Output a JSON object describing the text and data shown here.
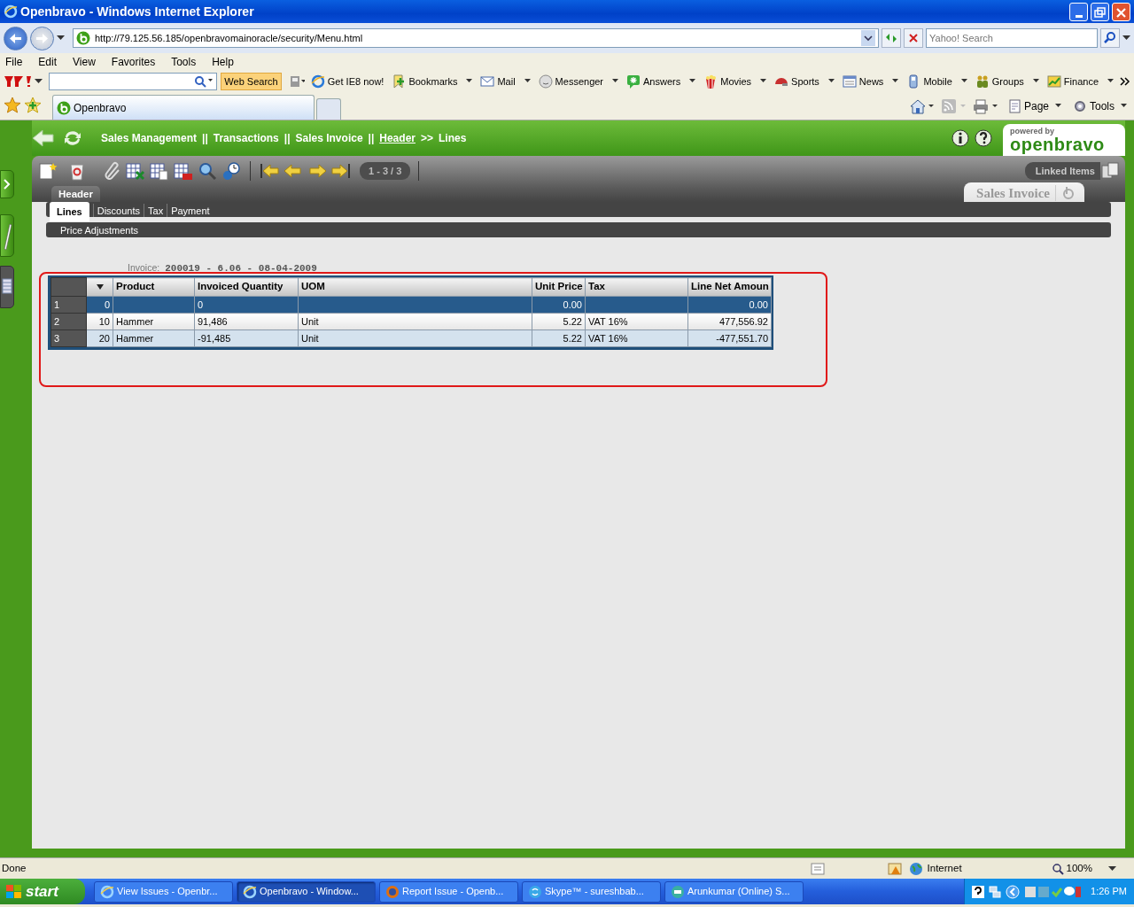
{
  "window": {
    "title": "Openbravo - Windows Internet Explorer"
  },
  "address_bar": {
    "url": "http://79.125.56.185/openbravomainoracle/security/Menu.html",
    "search_placeholder": "Yahoo! Search"
  },
  "menu_bar": [
    "File",
    "Edit",
    "View",
    "Favorites",
    "Tools",
    "Help"
  ],
  "yahoo_toolbar": {
    "search_button": "Web Search",
    "items": [
      {
        "label": "Get IE8 now!",
        "dropdown": false
      },
      {
        "label": "Bookmarks",
        "dropdown": true
      },
      {
        "label": "Mail",
        "dropdown": true
      },
      {
        "label": "Messenger",
        "dropdown": true
      },
      {
        "label": "Answers",
        "dropdown": true
      },
      {
        "label": "Movies",
        "dropdown": true
      },
      {
        "label": "Sports",
        "dropdown": true
      },
      {
        "label": "News",
        "dropdown": true
      },
      {
        "label": "Mobile",
        "dropdown": true
      },
      {
        "label": "Groups",
        "dropdown": true
      },
      {
        "label": "Finance",
        "dropdown": true
      }
    ]
  },
  "browser_tab": {
    "label": "Openbravo"
  },
  "command_bar": [
    "Page",
    "Tools"
  ],
  "app": {
    "breadcrumb": [
      {
        "text": "Sales Management",
        "kind": "crumb"
      },
      {
        "text": "||",
        "kind": "sep"
      },
      {
        "text": "Transactions",
        "kind": "crumb"
      },
      {
        "text": "||",
        "kind": "sep"
      },
      {
        "text": "Sales Invoice",
        "kind": "crumb"
      },
      {
        "text": "||",
        "kind": "sep"
      },
      {
        "text": "Header",
        "kind": "link"
      },
      {
        "text": ">>",
        "kind": "sep"
      },
      {
        "text": "Lines",
        "kind": "crumb"
      }
    ],
    "logo": {
      "caption": "powered by",
      "name": "openbravo"
    },
    "record_counter": "1 - 3 / 3",
    "linked_items": "Linked Items",
    "window_tab": "Sales Invoice",
    "parent_tab": "Header",
    "tabs": [
      {
        "label": "Lines",
        "selected": true
      },
      {
        "label": "Discounts",
        "selected": false
      },
      {
        "label": "Tax",
        "selected": false
      },
      {
        "label": "Payment",
        "selected": false
      }
    ],
    "subtabs": [
      {
        "label": "Price Adjustments",
        "selected": false
      }
    ],
    "record_info": {
      "label": "Invoice:",
      "value": "200019 - 6.06 - 08-04-2009"
    },
    "grid": {
      "columns": [
        "Product",
        "Invoiced Quantity",
        "UOM",
        "Unit Price",
        "Tax",
        "Line Net Amoun"
      ],
      "rows": [
        {
          "number": "1",
          "line": "0",
          "cells": [
            "",
            "0",
            "",
            "0.00",
            "",
            "0.00"
          ],
          "selected": true
        },
        {
          "number": "2",
          "line": "10",
          "cells": [
            "Hammer",
            "91,486",
            "Unit",
            "5.22",
            "VAT 16%",
            "477,556.92"
          ],
          "selected": false
        },
        {
          "number": "3",
          "line": "20",
          "cells": [
            "Hammer",
            "-91,485",
            "Unit",
            "5.22",
            "VAT 16%",
            "-477,551.70"
          ],
          "selected": false
        }
      ]
    }
  },
  "status_bar": {
    "text": "Done",
    "zone": "Internet",
    "zoom": "100%"
  },
  "taskbar": {
    "start": "start",
    "items": [
      {
        "label": "View Issues - Openbr...",
        "selected": false
      },
      {
        "label": "Openbravo - Window...",
        "selected": true
      },
      {
        "label": "Report Issue - Openb...",
        "selected": false
      },
      {
        "label": "Skype™ - sureshbab...",
        "selected": false
      },
      {
        "label": "Arunkumar (Online) S...",
        "selected": false
      }
    ],
    "clock": "1:26 PM"
  }
}
